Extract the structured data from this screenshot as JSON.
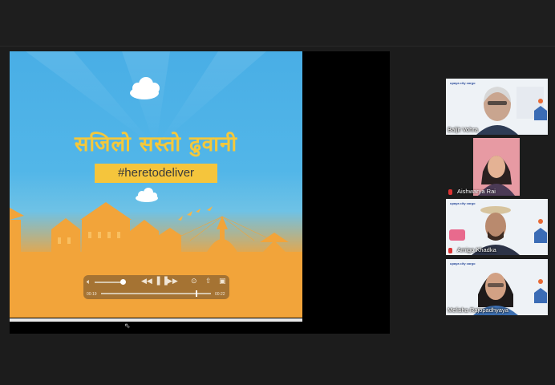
{
  "video": {
    "nepali_title": "सजिलो सस्तो ढुवानी",
    "hashtag": "#heretodeliver",
    "time_elapsed": "00:19",
    "time_remaining": "00:22"
  },
  "participants": [
    {
      "name": "Baljit Vohra",
      "brand": "upaya city cargo"
    },
    {
      "name": "Aishwarya Rai",
      "brand": ""
    },
    {
      "name": "Amigo Khadka",
      "brand": "upaya city cargo"
    },
    {
      "name": "Melisha Rajopadhyaya",
      "brand": "upaya city cargo"
    }
  ],
  "colors": {
    "sky": "#49aee6",
    "sand": "#f5a43a",
    "accent": "#f5c53c",
    "background": "#1c1c1c"
  },
  "icons": [
    "volume-icon",
    "rewind-icon",
    "pause-icon",
    "forward-icon",
    "airplay-icon",
    "share-icon",
    "pip-icon",
    "microphone-muted-icon",
    "cursor-icon"
  ]
}
